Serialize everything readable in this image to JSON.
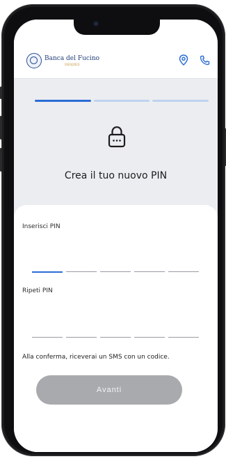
{
  "header": {
    "brand_name": "Banca del Fucino",
    "brand_years": "1923|2023",
    "location_icon": "location-pin-icon",
    "phone_icon": "phone-icon"
  },
  "progress": {
    "steps_total": 3,
    "steps_completed": 1
  },
  "hero": {
    "icon": "lock-icon",
    "title": "Crea il tuo nuovo PIN"
  },
  "form": {
    "pin_label": "Inserisci PIN",
    "repeat_pin_label": "Ripeti PIN",
    "pin_length": 5,
    "confirm_note": "Alla conferma, riceverai un SMS con un codice.",
    "submit_label": "Avanti"
  },
  "colors": {
    "accent": "#2b6cd6",
    "accent_light": "#bfd3f0",
    "button_disabled": "#a9aaad",
    "background": "#ecedf0",
    "brand_blue": "#1f3c78",
    "brand_gold": "#c08a2b"
  }
}
